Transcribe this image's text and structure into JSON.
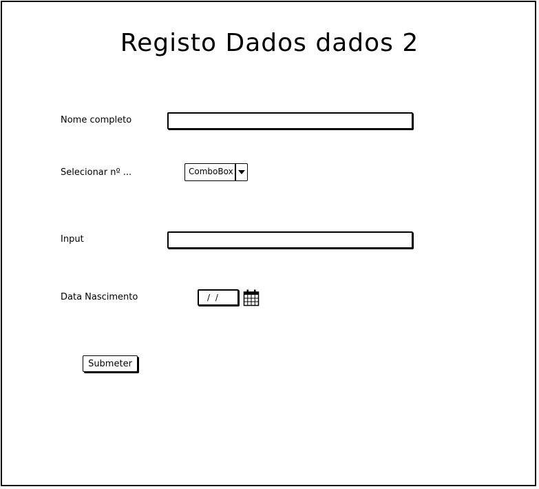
{
  "form": {
    "title": "Registo Dados dados 2",
    "fields": {
      "nome_label": "Nome completo",
      "nome_value": "",
      "selecionar_label": "Selecionar nº ...",
      "combo_value": "ComboBox",
      "input_label": "Input",
      "input_value": "",
      "data_label": "Data Nascimento",
      "data_value": "/ /"
    },
    "submit_label": "Submeter"
  },
  "icons": {
    "combo_arrow": "chevron-down-icon",
    "date_picker": "calendar-icon"
  }
}
